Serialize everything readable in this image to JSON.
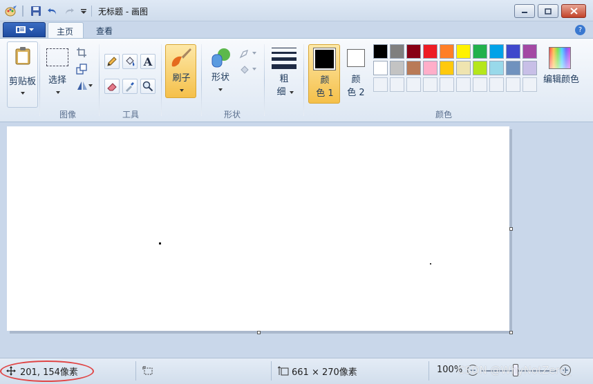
{
  "window": {
    "title": "无标题 - 画图"
  },
  "tabs": [
    {
      "label": "主页",
      "active": true
    },
    {
      "label": "查看",
      "active": false
    }
  ],
  "ribbon": {
    "clipboard": {
      "label": "剪贴板",
      "icon": "clipboard-icon"
    },
    "image": {
      "select_label": "选择",
      "group_label": "图像",
      "icons": [
        "crop-icon",
        "resize-icon",
        "rotate-icon"
      ]
    },
    "tools": {
      "group_label": "工具",
      "icons": [
        "pencil-icon",
        "fill-icon",
        "text-icon",
        "eraser-icon",
        "color-picker-icon",
        "magnifier-icon"
      ],
      "text_glyph": "A"
    },
    "brush": {
      "label": "刷子",
      "icon": "brush-icon"
    },
    "shapes": {
      "label": "形状",
      "group_label": "形状",
      "icons": [
        "shapes-icon",
        "outline-icon",
        "fill-shape-icon"
      ]
    },
    "size": {
      "label_line1": "粗",
      "label_line2": "细"
    },
    "color1": {
      "label_line1": "颜",
      "label_line2": "色 1",
      "color": "#000000"
    },
    "color2": {
      "label_line1": "颜",
      "label_line2": "色 2",
      "color": "#ffffff"
    },
    "colors": {
      "group_label": "颜色",
      "edit_label": "编辑颜色",
      "row1": [
        "#000000",
        "#7f7f7f",
        "#880015",
        "#ed1c24",
        "#ff7f27",
        "#fff200",
        "#22b14c",
        "#00a2e8",
        "#3f48cc",
        "#a349a4"
      ],
      "row2": [
        "#ffffff",
        "#c3c3c3",
        "#b97a57",
        "#ffaec9",
        "#ffc90e",
        "#efe4b0",
        "#b5e61d",
        "#99d9ea",
        "#7092be",
        "#c8bfe7"
      ]
    },
    "accent": "#f5c04a"
  },
  "status": {
    "cursor_position": "201, 154像素",
    "image_size": "661 × 270像素",
    "zoom": "100%",
    "watermark": "CSDN @WhyNotZero_"
  }
}
